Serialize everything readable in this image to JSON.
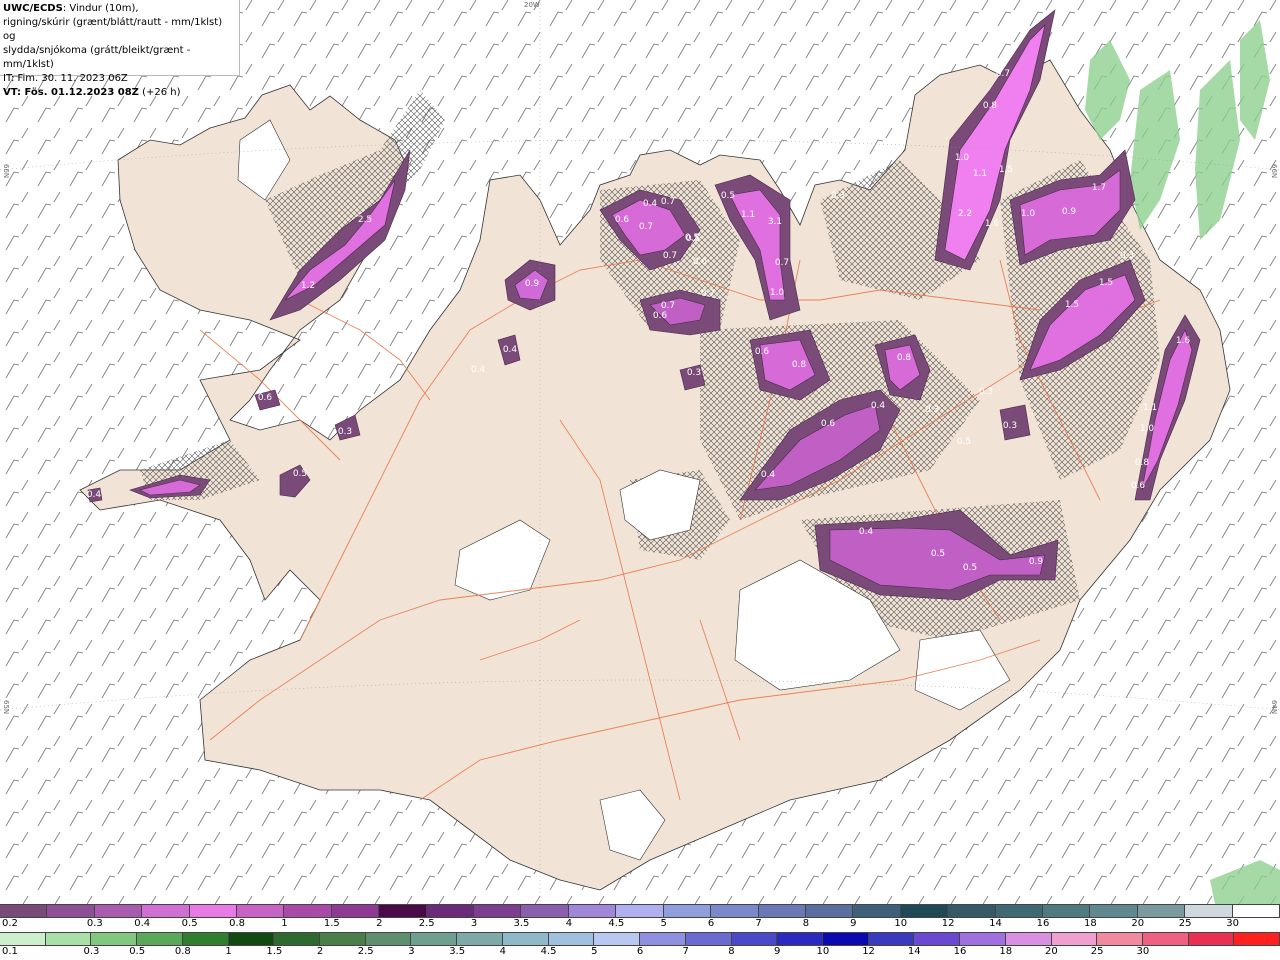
{
  "info": {
    "line1_bold": "UWC/ECDS",
    "line1_rest": ": Vindur (10m),",
    "line2": "rigning/skúrir (grænt/blátt/rautt - mm/1klst) og",
    "line3": "slydda/snjókoma (grátt/bleikt/grænt - mm/1klst)",
    "line4": "IT: Fim. 30. 11. 2023 06Z",
    "line5_bold": "VT: Fös. 01.12.2023 08Z",
    "line5_rest": " (+26 h)"
  },
  "edge_labels": {
    "top": "20W",
    "left_upper": "66N",
    "left_lower": "65N",
    "right_upper": "66N",
    "right_lower": "64N"
  },
  "map_labels": [
    "2.5",
    "1.2",
    "0.6",
    "0.3",
    "0.5",
    "0.7",
    "0.6",
    "0.4",
    "0.9",
    "0.4",
    "0.4",
    "0.6",
    "0.4",
    "0.7",
    "0.7",
    "0.5",
    "0.7",
    "0.6",
    "0.7",
    "0.3",
    "0.5",
    "1.1",
    "3.1",
    "0.7",
    "1.0",
    "0.5",
    "0.3",
    "0.6",
    "0.8",
    "0.4",
    "0.6",
    "0.8",
    "0.4",
    "0.3",
    "0.5",
    "0.3",
    "0.3",
    "0.7",
    "0.8",
    "1.0",
    "1.1",
    "1.5",
    "2.2",
    "1.6",
    "1.0",
    "0.9",
    "1.7",
    "1.5",
    "1.3",
    "1.5",
    "0.3",
    "1.6",
    "1.1",
    "1.0",
    "0.8",
    "0.6",
    "0.3",
    "0.3",
    "0.3",
    "0.4",
    "0.5",
    "0.5",
    "0.9"
  ],
  "legend_top": {
    "colors": [
      "#7a4a78",
      "#8f4f96",
      "#a95bb0",
      "#cf6fd3",
      "#e87ae6",
      "#c763c4",
      "#a94aa9",
      "#8e3a95",
      "#4a0a4a",
      "#6b2a7a",
      "#7c3f8f",
      "#8a5fb0",
      "#9f86d9",
      "#b0b0f0",
      "#8f9fdd",
      "#7a88cc",
      "#6a78b8",
      "#5a6fa0",
      "#3f5f7a",
      "#1f4a55",
      "#355a66",
      "#3f6a75",
      "#4f7a80",
      "#608890",
      "#7a9aa0",
      "#cfd8dc",
      "#ffffff"
    ],
    "labels": [
      "0.2",
      "0.3",
      "0.4",
      "0.5",
      "0.8",
      "1",
      "1.5",
      "2",
      "2.5",
      "3",
      "3.5",
      "4",
      "4.5",
      "5",
      "6",
      "7",
      "8",
      "9",
      "10",
      "12",
      "14",
      "16",
      "18",
      "20",
      "25",
      "30"
    ]
  },
  "legend_bottom": {
    "colors": [
      "#ccf0cc",
      "#a8e0a8",
      "#80c880",
      "#5aa85a",
      "#2f7f2f",
      "#104a10",
      "#2e6a2e",
      "#4a7f4a",
      "#5f8f6f",
      "#6f9f8f",
      "#7fa8a8",
      "#8fb8c8",
      "#a0c0e0",
      "#b8c8f0",
      "#9090e0",
      "#6a6ad0",
      "#4a4ac8",
      "#2a2ac0",
      "#0a0ab0",
      "#3a3ac0",
      "#6a4ad0",
      "#a070e0",
      "#d890e0",
      "#f0a0d0",
      "#f08aa0",
      "#f06080",
      "#e83050",
      "#ff2020"
    ],
    "labels": [
      "0.1",
      "0.3",
      "0.5",
      "0.8",
      "1",
      "1.5",
      "2",
      "2.5",
      "3",
      "3.5",
      "4",
      "4.5",
      "5",
      "6",
      "7",
      "8",
      "9",
      "10",
      "12",
      "14",
      "16",
      "18",
      "20",
      "25",
      "30"
    ]
  }
}
